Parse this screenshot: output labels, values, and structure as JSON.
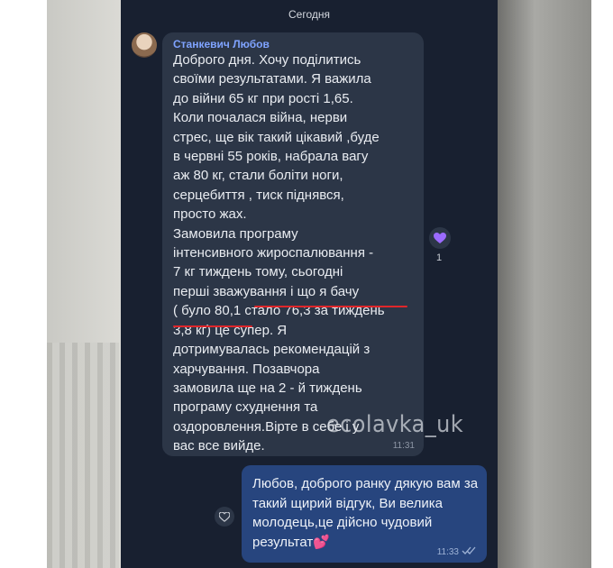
{
  "chat": {
    "date_label": "Сегодня",
    "incoming": {
      "sender": "Станкевич Любов",
      "text": "Доброго дня. Хочу поділитись\nсвоїми результатами. Я важила\nдо війни 65 кг при рості 1,65.\nКоли почалася війна, нерви\nстрес, ще вік такий цікавий ,буде\nв червні 55 років, набрала вагу\nаж 80 кг, стали боліти ноги,\nсерцебиття , тиск піднявся,\nпросто жах.\nЗамовила програму\nінтенсивного жироспалювання -\n7 кг тиждень тому, сьогодні\nперші зважування і що я бачу\n( було 80,1 стало 76,3 за тиждень\n3,8 кг) це супер. Я\nдотримувалась рекомендацій з\nхарчування.  Позавчора\nзамовила ще на 2 - й тиждень\nпрограму схуднення та\nоздоровлення.Вірте в себе і у\nвас все вийде.",
      "time": "11:31",
      "reaction_icon": "purple-heart-icon",
      "reaction_count": "1"
    },
    "watermark": "ecolavka_uk",
    "outgoing": {
      "text": "Любов, доброго ранку дякую вам за такий щирий відгук, Ви велика молодець,це дійсно чудовий результат💕",
      "time": "11:33",
      "status_icon": "double-check-icon"
    }
  },
  "colors": {
    "chat_bg": "#182030",
    "incoming_bubble": "#2c3647",
    "outgoing_bubble": "#27457e",
    "sender_name": "#7fa3ff",
    "annotation_red": "#e0262a",
    "reaction_purple": "#9b6bff"
  }
}
